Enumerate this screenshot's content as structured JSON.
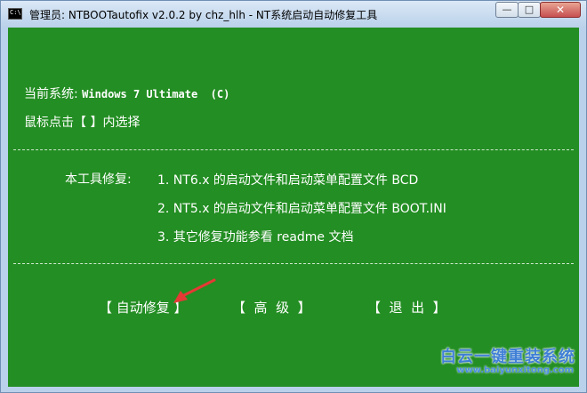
{
  "window": {
    "title": "管理员:  NTBOOTautofix v2.0.2 by chz_hlh - NT系统启动自动修复工具",
    "icon_text": "C:\\",
    "controls": {
      "minimize": "—",
      "maximize": "□",
      "close": "✕"
    }
  },
  "console": {
    "current_system_label": "当前系统: ",
    "current_system_value": "Windows 7 Ultimate  (C)",
    "hint": "鼠标点击【 】内选择",
    "repair_intro": "本工具修复:",
    "items": [
      "1. NT6.x 的启动文件和启动菜单配置文件 BCD",
      "2. NT5.x 的启动文件和启动菜单配置文件 BOOT.INI",
      "3. 其它修复功能参看 readme 文档"
    ]
  },
  "buttons": {
    "auto_repair": "【 自动修复 】",
    "advanced": "【  高  级  】",
    "exit": "【  退  出  】"
  },
  "watermark": {
    "brand": "白云一键重装系统",
    "url": "www.baiyunxitong.com"
  },
  "colors": {
    "console_bg": "#238e23",
    "annotation_arrow": "#e53935"
  }
}
